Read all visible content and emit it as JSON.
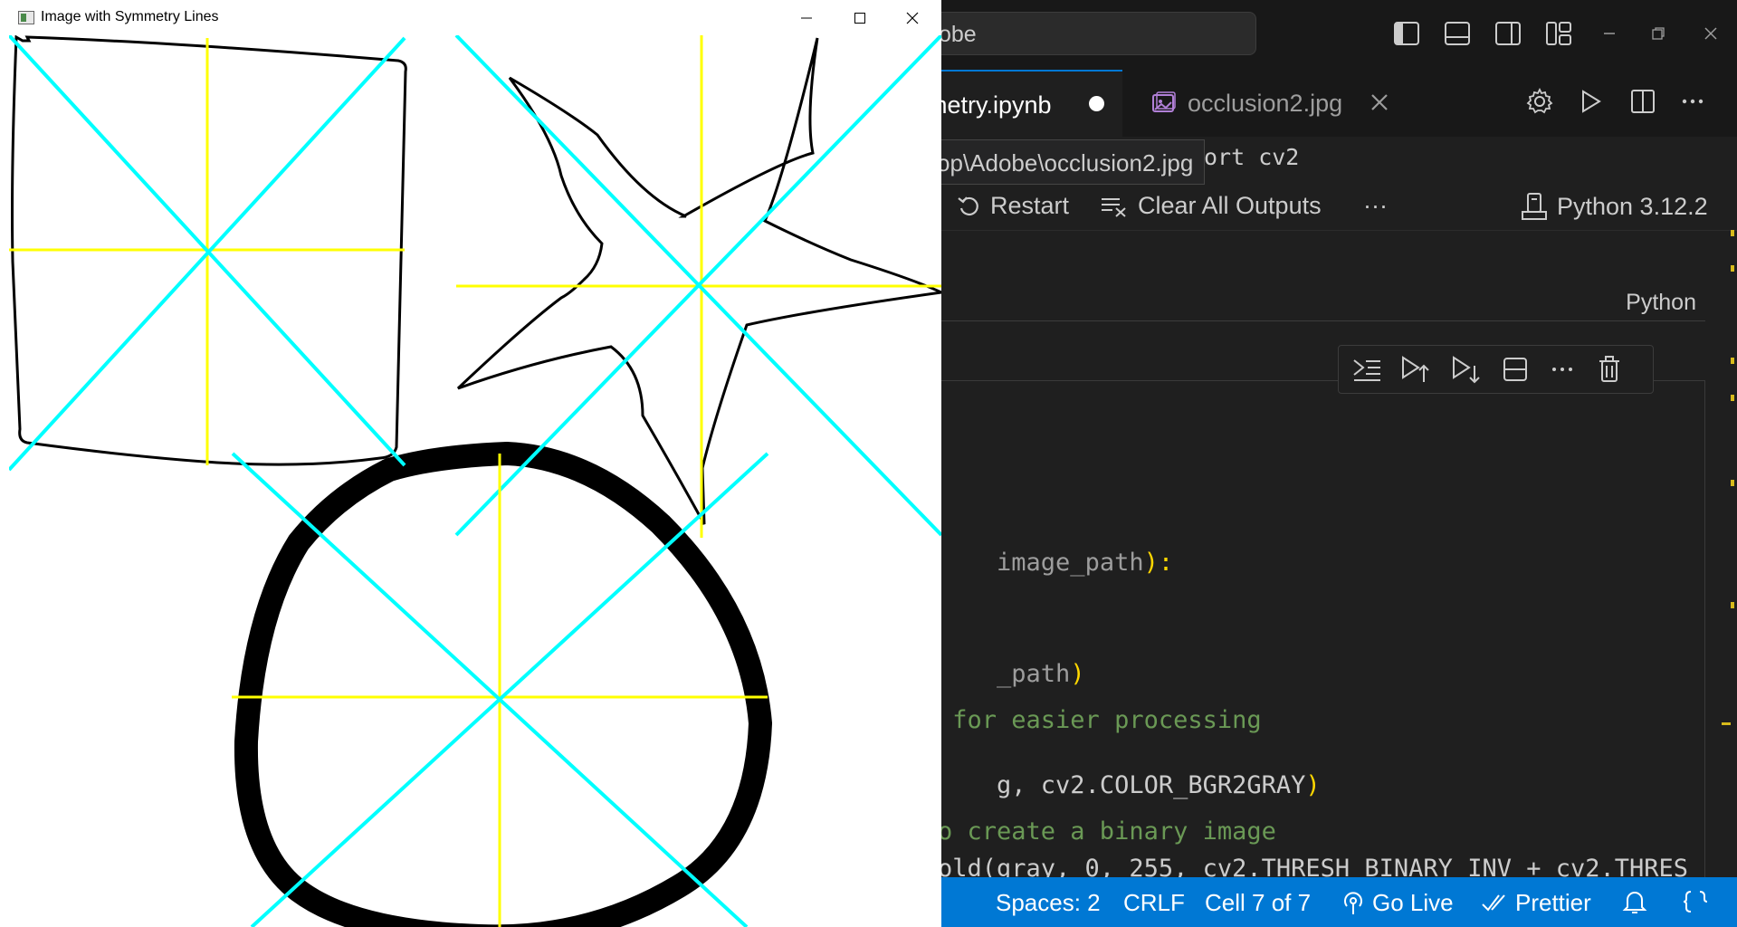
{
  "vscode": {
    "search_text": "obe",
    "tabs": [
      {
        "label": "metry.ipynb",
        "modified": true
      },
      {
        "label": "occlusion2.jpg"
      }
    ],
    "tooltip": "op\\Adobe\\occlusion2.jpg",
    "breadcrumb_code": "ort cv2",
    "toolbar": {
      "restart": "Restart",
      "clear_outputs": "Clear All Outputs",
      "more": "···",
      "kernel": "Python 3.12.2"
    },
    "prev_cell_lang": "Python",
    "code_lines": [
      {
        "pre": "",
        "var": "image_path",
        "post": "):",
        "kind": "sig"
      },
      {
        "pre": "_path",
        "post": ")",
        "kind": "call"
      },
      {
        "text": " for easier processing",
        "kind": "comment"
      },
      {
        "text": "g, cv2.COLOR_BGR2GRAY",
        "post": ")",
        "kind": "call2"
      },
      {
        "text": "o create a binary image",
        "kind": "comment"
      },
      {
        "text": "old(gray, 0, 255, cv2.THRESH_BINARY_INV + cv2.THRES",
        "kind": "code"
      }
    ],
    "statusbar": {
      "spaces": "Spaces: 2",
      "eol": "CRLF",
      "cell": "Cell 7 of 7",
      "go_live": "Go Live",
      "prettier": "Prettier"
    },
    "colors": {
      "accent": "#0078d4",
      "status_bar": "#0078d4",
      "comment": "#6a9955",
      "paren": "#ffd700",
      "symmetry_axis": "#ffff00",
      "symmetry_diagonal": "#00ffff"
    }
  },
  "cv_window": {
    "title": "Image with Symmetry Lines"
  }
}
